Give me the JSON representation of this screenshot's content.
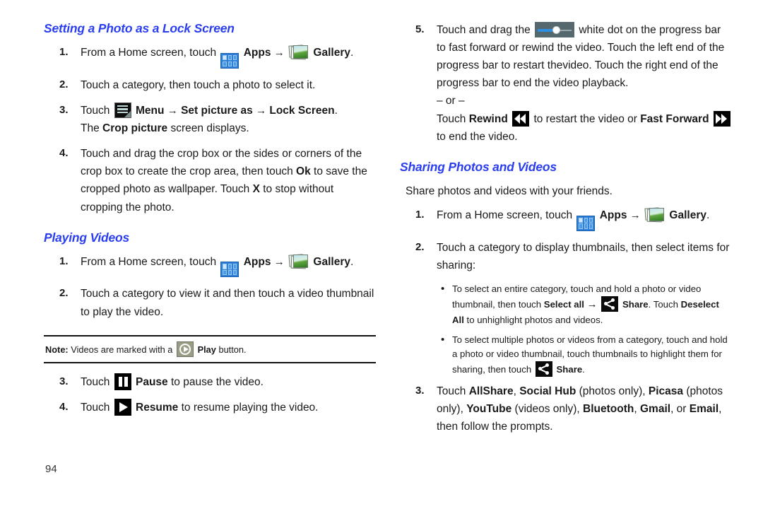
{
  "page_number": "94",
  "left_column": {
    "heading1": "Setting a Photo as a Lock Screen",
    "steps1": [
      {
        "num": "1.",
        "pre": "From a Home screen, touch",
        "apps_label": "Apps",
        "arrow": "→",
        "gallery_label": "Gallery",
        "post": "."
      },
      {
        "num": "2.",
        "text": "Touch a category, then touch a photo to select it."
      },
      {
        "num": "3.",
        "pre": "Touch",
        "menu_label": "Menu",
        "arrow1": "→",
        "setpic_label": "Set picture as",
        "arrow2": "→",
        "lock_label": "Lock Screen",
        "post": ".",
        "sub_pre": "The",
        "sub_bold": "Crop picture",
        "sub_post": "screen displays."
      },
      {
        "num": "4.",
        "t1": "Touch and drag the crop box or the sides or corners of the crop box to create the crop area, then touch",
        "b1": "Ok",
        "t2": "to save the cropped photo as wallpaper. Touch",
        "b2": "X",
        "t3": "to stop without cropping the photo."
      }
    ],
    "heading2": "Playing Videos",
    "steps2": [
      {
        "num": "1.",
        "pre": "From a Home screen, touch",
        "apps_label": "Apps",
        "arrow": "→",
        "gallery_label": "Gallery",
        "post": "."
      },
      {
        "num": "2.",
        "text": "Touch a category to view it and then touch a video thumbnail to play the video."
      }
    ],
    "note": {
      "label": "Note:",
      "pre": "Videos are marked with a",
      "bold": "Play",
      "post": "button."
    },
    "steps3": [
      {
        "num": "3.",
        "pre": "Touch",
        "bold": "Pause",
        "post": "to pause the video."
      },
      {
        "num": "4.",
        "pre": "Touch",
        "bold": "Resume",
        "post": "to resume playing the video."
      }
    ]
  },
  "right_column": {
    "step5": {
      "num": "5.",
      "pre": "Touch and drag the",
      "post": "white dot on the progress bar to fast forward or rewind the video. Touch the left end of the progress bar to restart thevideo. Touch the right end of the progress bar to end the video playback.",
      "or": "– or –",
      "alt_pre": "Touch",
      "alt_b1": "Rewind",
      "alt_mid": "to restart the video or",
      "alt_b2": "Fast Forward",
      "alt_post": "to end the video."
    },
    "heading1": "Sharing Photos and Videos",
    "intro": "Share photos and videos with your friends.",
    "steps": [
      {
        "num": "1.",
        "pre": "From a Home screen, touch",
        "apps_label": "Apps",
        "arrow": "→",
        "gallery_label": "Gallery",
        "post": "."
      },
      {
        "num": "2.",
        "text": "Touch a category to display thumbnails, then select items for sharing:"
      }
    ],
    "bullets": [
      {
        "t1": "To select an entire category, touch and hold a photo or video thumbnail, then touch",
        "b1": "Select all",
        "arrow": "→",
        "b2": "Share",
        "t2": ". Touch",
        "b3": "Deselect All",
        "t3": "to unhighlight photos and videos."
      },
      {
        "t1": "To select multiple photos or videos from a category, touch and hold a photo or video thumbnail, touch thumbnails to highlight them for sharing, then touch",
        "b1": "Share",
        "t2": "."
      }
    ],
    "step3": {
      "num": "3.",
      "pre": "Touch",
      "b1": "AllShare",
      "s1": ",",
      "b2": "Social Hub",
      "s2": "(photos only),",
      "b3": "Picasa",
      "s3": "(photos only),",
      "b4": "YouTube",
      "s4": "(videos only),",
      "b5": "Bluetooth",
      "s5": ",",
      "b6": "Gmail",
      "s6": ", or",
      "b7": "Email",
      "s7": ", then follow the prompts."
    }
  }
}
